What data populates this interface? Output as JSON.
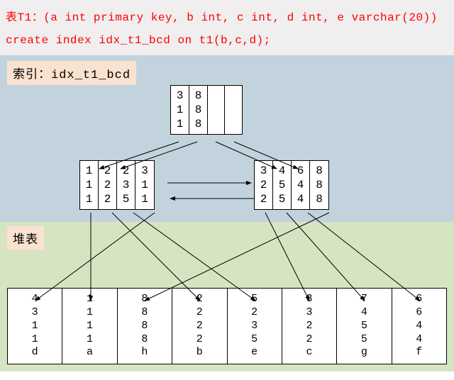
{
  "header": {
    "schema": "表T1：(a int primary key, b int, c int, d int, e varchar(20))",
    "create_index": "create index idx_t1_bcd on t1(b,c,d);"
  },
  "index_label": "索引：idx_t1_bcd",
  "heap_label": "堆表",
  "chart_data": {
    "type": "diagram",
    "description": "B-tree index (idx_t1_bcd on columns b,c,d) pointing into heap table T1(a,b,c,d,e)",
    "index_tree": {
      "root": {
        "keys": [
          {
            "b": 3,
            "c": 1,
            "d": 1
          },
          {
            "b": 8,
            "c": 8,
            "d": 8
          }
        ],
        "empty_slots": 2
      },
      "leaves": [
        {
          "keys": [
            {
              "b": 1,
              "c": 1,
              "d": 1
            },
            {
              "b": 2,
              "c": 2,
              "d": 2
            },
            {
              "b": 2,
              "c": 3,
              "d": 5
            },
            {
              "b": 3,
              "c": 1,
              "d": 1
            }
          ]
        },
        {
          "keys": [
            {
              "b": 3,
              "c": 2,
              "d": 2
            },
            {
              "b": 4,
              "c": 5,
              "d": 5
            },
            {
              "b": 6,
              "c": 4,
              "d": 4
            },
            {
              "b": 8,
              "c": 8,
              "d": 8
            }
          ]
        }
      ],
      "leaf_sibling_links": "bidirectional"
    },
    "heap_rows": [
      {
        "a": 4,
        "b": 3,
        "c": 1,
        "d": 1,
        "e": "d"
      },
      {
        "a": 1,
        "b": 1,
        "c": 1,
        "d": 1,
        "e": "a"
      },
      {
        "a": 8,
        "b": 8,
        "c": 8,
        "d": 8,
        "e": "h"
      },
      {
        "a": 2,
        "b": 2,
        "c": 2,
        "d": 2,
        "e": "b"
      },
      {
        "a": 5,
        "b": 2,
        "c": 3,
        "d": 5,
        "e": "e"
      },
      {
        "a": 3,
        "b": 3,
        "c": 2,
        "d": 2,
        "e": "c"
      },
      {
        "a": 7,
        "b": 4,
        "c": 5,
        "d": 5,
        "e": "g"
      },
      {
        "a": 6,
        "b": 6,
        "c": 4,
        "d": 4,
        "e": "f"
      }
    ],
    "index_to_heap_pointers": [
      {
        "leaf": 0,
        "key_index": 0,
        "heap_row": 1
      },
      {
        "leaf": 0,
        "key_index": 1,
        "heap_row": 3
      },
      {
        "leaf": 0,
        "key_index": 2,
        "heap_row": 4
      },
      {
        "leaf": 0,
        "key_index": 3,
        "heap_row": 0
      },
      {
        "leaf": 1,
        "key_index": 0,
        "heap_row": 5
      },
      {
        "leaf": 1,
        "key_index": 1,
        "heap_row": 6
      },
      {
        "leaf": 1,
        "key_index": 2,
        "heap_row": 7
      },
      {
        "leaf": 1,
        "key_index": 3,
        "heap_row": 2
      }
    ]
  },
  "root_cells": [
    "3\n1\n1",
    "8\n8\n8",
    "",
    ""
  ],
  "leaf_left_cells": [
    "1\n1\n1",
    "2\n2\n2",
    "2\n3\n5",
    "3\n1\n1"
  ],
  "leaf_right_cells": [
    "3\n2\n2",
    "4\n5\n5",
    "6\n4\n4",
    "8\n8\n8"
  ],
  "heap_cells": [
    "4\n3\n1\n1\nd",
    "1\n1\n1\n1\na",
    "8\n8\n8\n8\nh",
    "2\n2\n2\n2\nb",
    "5\n2\n3\n5\ne",
    "3\n3\n2\n2\nc",
    "7\n4\n5\n5\ng",
    "6\n6\n4\n4\nf"
  ]
}
